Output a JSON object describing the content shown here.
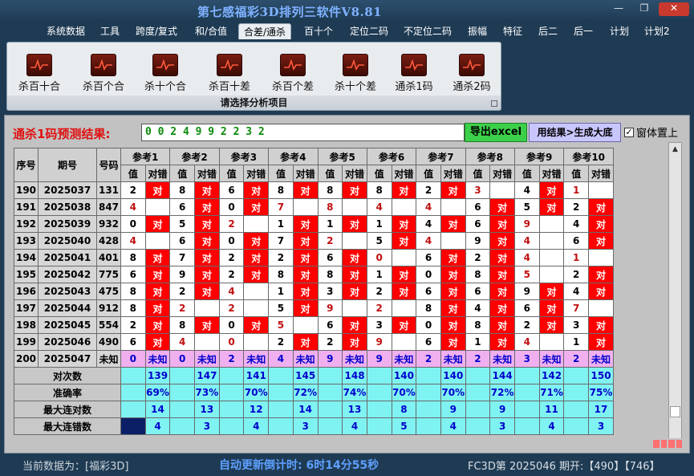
{
  "window": {
    "title": "第七感福彩3D排列三软件V8.81",
    "minimize": "—",
    "maximize": "❐",
    "close": "✕"
  },
  "menu": [
    {
      "label": "系统数据",
      "active": false
    },
    {
      "label": "工具",
      "active": false
    },
    {
      "label": "跨度/复式",
      "active": false
    },
    {
      "label": "和/合值",
      "active": false
    },
    {
      "label": "合差/通杀",
      "active": true
    },
    {
      "label": "百十个",
      "active": false
    },
    {
      "label": "定位二码",
      "active": false
    },
    {
      "label": "不定位二码",
      "active": false
    },
    {
      "label": "振幅",
      "active": false
    },
    {
      "label": "特征",
      "active": false
    },
    {
      "label": "后二",
      "active": false
    },
    {
      "label": "后一",
      "active": false
    },
    {
      "label": "计划",
      "active": false
    },
    {
      "label": "计划2",
      "active": false
    }
  ],
  "ribbon": {
    "caption": "请选择分析项目",
    "buttons": [
      {
        "label": "杀百十合",
        "icon": "chart-icon"
      },
      {
        "label": "杀百个合",
        "icon": "chart-icon"
      },
      {
        "label": "杀十个合",
        "icon": "chart-icon"
      },
      {
        "label": "杀百十差",
        "icon": "chart-icon"
      },
      {
        "label": "杀百个差",
        "icon": "chart-icon"
      },
      {
        "label": "杀十个差",
        "icon": "chart-icon"
      },
      {
        "label": "通杀1码",
        "icon": "chart-icon"
      },
      {
        "label": "通杀2码",
        "icon": "chart-icon"
      }
    ]
  },
  "prediction": {
    "label": "通杀1码预测结果:",
    "value": "0 0 2 4 9 9 2 2 3 2",
    "export_button": "导出excel",
    "generate_button": "用结果>生成大底",
    "on_top_label": "窗体置上",
    "on_top_checked": true
  },
  "grid": {
    "headers": {
      "seq": "序号",
      "period": "期号",
      "number": "号码",
      "value": "值",
      "match": "对错"
    },
    "refs": [
      "参考1",
      "参考2",
      "参考3",
      "参考4",
      "参考5",
      "参考6",
      "参考7",
      "参考8",
      "参考9",
      "参考10"
    ],
    "hit_text": "对",
    "rows": [
      {
        "seq": "190",
        "period": "2025037",
        "number": "131",
        "cells": [
          [
            "2",
            1
          ],
          [
            "8",
            1
          ],
          [
            "6",
            1
          ],
          [
            "8",
            1
          ],
          [
            "8",
            1
          ],
          [
            "8",
            1
          ],
          [
            "2",
            1
          ],
          [
            "3r",
            0
          ],
          [
            "4",
            1
          ],
          [
            "1r",
            0
          ]
        ]
      },
      {
        "seq": "191",
        "period": "2025038",
        "number": "847",
        "cells": [
          [
            "4r",
            0
          ],
          [
            "6",
            1
          ],
          [
            "0",
            1
          ],
          [
            "7r",
            0
          ],
          [
            "8r",
            0
          ],
          [
            "4r",
            0
          ],
          [
            "4r",
            0
          ],
          [
            "6",
            1
          ],
          [
            "5",
            1
          ],
          [
            "2",
            1
          ]
        ]
      },
      {
        "seq": "192",
        "period": "2025039",
        "number": "932",
        "cells": [
          [
            "0",
            1
          ],
          [
            "5",
            1
          ],
          [
            "2r",
            0
          ],
          [
            "1",
            1
          ],
          [
            "1",
            1
          ],
          [
            "1",
            1
          ],
          [
            "4",
            1
          ],
          [
            "6",
            1
          ],
          [
            "9r",
            0
          ],
          [
            "4",
            1
          ]
        ]
      },
      {
        "seq": "193",
        "period": "2025040",
        "number": "428",
        "cells": [
          [
            "4r",
            0
          ],
          [
            "6",
            1
          ],
          [
            "0",
            1
          ],
          [
            "7",
            1
          ],
          [
            "2r",
            0
          ],
          [
            "5",
            1
          ],
          [
            "4r",
            0
          ],
          [
            "9",
            1
          ],
          [
            "4r",
            0
          ],
          [
            "6",
            1
          ]
        ]
      },
      {
        "seq": "194",
        "period": "2025041",
        "number": "401",
        "cells": [
          [
            "8",
            1
          ],
          [
            "7",
            1
          ],
          [
            "2",
            1
          ],
          [
            "2",
            1
          ],
          [
            "6",
            1
          ],
          [
            "0r",
            0
          ],
          [
            "6",
            1
          ],
          [
            "2",
            1
          ],
          [
            "4r",
            0
          ],
          [
            "1r",
            0
          ]
        ]
      },
      {
        "seq": "195",
        "period": "2025042",
        "number": "775",
        "cells": [
          [
            "6",
            1
          ],
          [
            "9",
            1
          ],
          [
            "2",
            1
          ],
          [
            "8",
            1
          ],
          [
            "8",
            1
          ],
          [
            "1",
            1
          ],
          [
            "0",
            1
          ],
          [
            "8",
            1
          ],
          [
            "5r",
            0
          ],
          [
            "2",
            1
          ]
        ]
      },
      {
        "seq": "196",
        "period": "2025043",
        "number": "475",
        "cells": [
          [
            "8",
            1
          ],
          [
            "2",
            1
          ],
          [
            "4r",
            0
          ],
          [
            "1",
            1
          ],
          [
            "3",
            1
          ],
          [
            "2",
            1
          ],
          [
            "6",
            1
          ],
          [
            "6",
            1
          ],
          [
            "9",
            1
          ],
          [
            "4",
            1
          ]
        ]
      },
      {
        "seq": "197",
        "period": "2025044",
        "number": "912",
        "cells": [
          [
            "8",
            1
          ],
          [
            "2r",
            0
          ],
          [
            "2r",
            0
          ],
          [
            "5",
            1
          ],
          [
            "9r",
            0
          ],
          [
            "2r",
            0
          ],
          [
            "8",
            1
          ],
          [
            "4",
            1
          ],
          [
            "6",
            1
          ],
          [
            "7r",
            0
          ]
        ]
      },
      {
        "seq": "198",
        "period": "2025045",
        "number": "554",
        "cells": [
          [
            "2",
            1
          ],
          [
            "8",
            1
          ],
          [
            "0",
            1
          ],
          [
            "5r",
            0
          ],
          [
            "6",
            1
          ],
          [
            "3",
            1
          ],
          [
            "0",
            1
          ],
          [
            "8",
            1
          ],
          [
            "2",
            1
          ],
          [
            "3",
            1
          ]
        ]
      },
      {
        "seq": "199",
        "period": "2025046",
        "number": "490",
        "cells": [
          [
            "6",
            1
          ],
          [
            "4r",
            0
          ],
          [
            "0r",
            0
          ],
          [
            "2",
            1
          ],
          [
            "2",
            1
          ],
          [
            "9r",
            0
          ],
          [
            "6",
            1
          ],
          [
            "1",
            1
          ],
          [
            "4r",
            0
          ],
          [
            "1",
            1
          ]
        ]
      }
    ],
    "pending": {
      "seq": "200",
      "period": "2025047",
      "number": "未知",
      "values": [
        "0",
        "0",
        "2",
        "4",
        "9",
        "9",
        "2",
        "2",
        "3",
        "2"
      ],
      "status": "未知"
    },
    "stats": [
      {
        "label": "对次数",
        "values": [
          "139",
          "147",
          "141",
          "145",
          "148",
          "140",
          "140",
          "144",
          "142",
          "150"
        ]
      },
      {
        "label": "准确率",
        "values": [
          "69%",
          "73%",
          "70%",
          "72%",
          "74%",
          "70%",
          "70%",
          "72%",
          "71%",
          "75%"
        ]
      },
      {
        "label": "最大连对数",
        "values": [
          "14",
          "13",
          "12",
          "14",
          "13",
          "8",
          "9",
          "9",
          "11",
          "17"
        ]
      },
      {
        "label": "最大连错数",
        "values": [
          "4",
          "3",
          "4",
          "3",
          "4",
          "5",
          "4",
          "3",
          "4",
          "3"
        ]
      }
    ]
  },
  "status": {
    "current_data": "当前数据为：[福彩3D]",
    "countdown": "自动更新倒计时:  6时14分55秒",
    "latest": "FC3D第 2025046 期开:【490】【746】"
  }
}
